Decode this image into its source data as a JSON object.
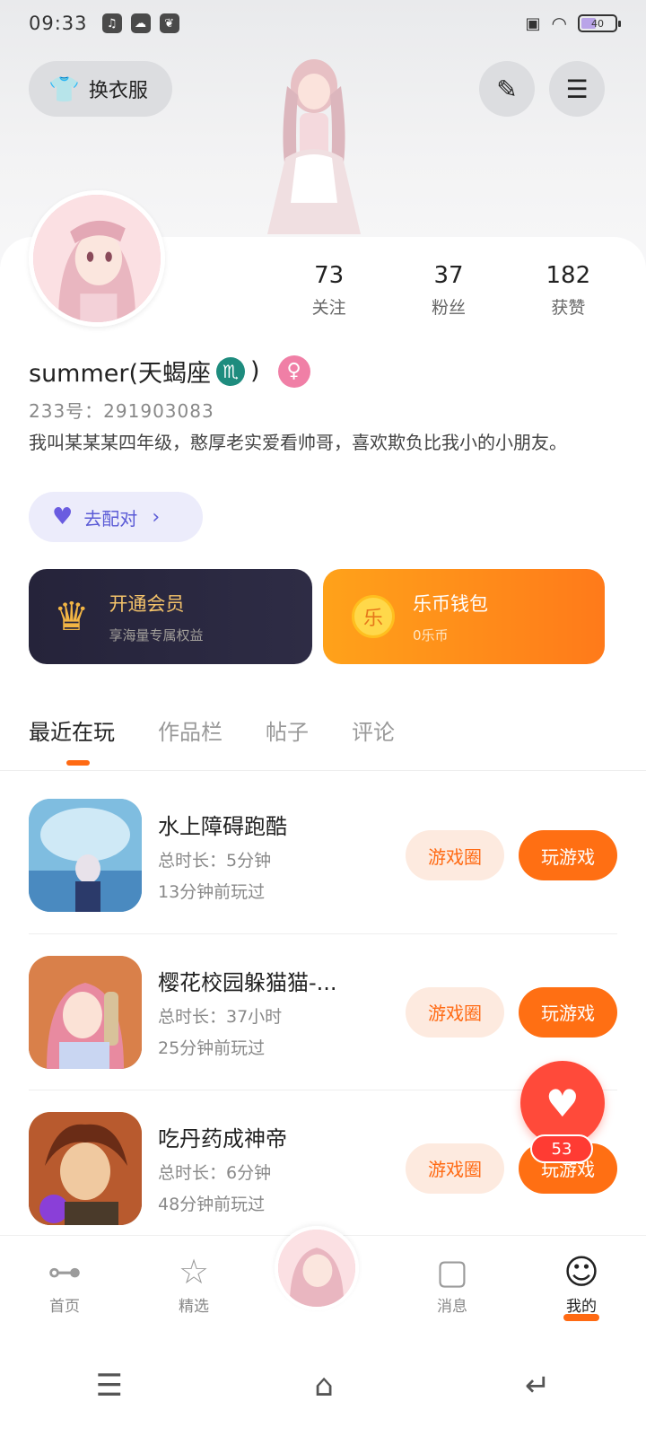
{
  "status_bar": {
    "time": "09:33",
    "battery": "40"
  },
  "header": {
    "dressup_label": "换衣服"
  },
  "profile": {
    "stats": [
      {
        "value": "73",
        "label": "关注"
      },
      {
        "value": "37",
        "label": "粉丝"
      },
      {
        "value": "182",
        "label": "获赞"
      }
    ],
    "username": "summer(天蝎座",
    "username_suffix": ")",
    "zodiac_symbol": "♏",
    "gender_symbol": "♀",
    "uid": "233号：291903083",
    "bio": "我叫某某某四年级，憨厚老实爱看帅哥，喜欢欺负比我小的小朋友。",
    "match_label": "去配对"
  },
  "cards": {
    "vip_title": "开通会员",
    "vip_sub": "享海量专属权益",
    "wallet_coin": "乐",
    "wallet_title": "乐币钱包",
    "wallet_sub": "0乐币"
  },
  "tabs": [
    {
      "label": "最近在玩",
      "active": true
    },
    {
      "label": "作品栏",
      "active": false
    },
    {
      "label": "帖子",
      "active": false
    },
    {
      "label": "评论",
      "active": false
    }
  ],
  "games": [
    {
      "title": "水上障碍跑酷",
      "duration": "总时长：5分钟",
      "last_played": "13分钟前玩过",
      "circle_label": "游戏圈",
      "play_label": "玩游戏"
    },
    {
      "title": "樱花校园躲猫猫-...",
      "duration": "总时长：37小时",
      "last_played": "25分钟前玩过",
      "circle_label": "游戏圈",
      "play_label": "玩游戏"
    },
    {
      "title": "吃丹药成神帝",
      "duration": "总时长：6分钟",
      "last_played": "48分钟前玩过",
      "circle_label": "游戏圈",
      "play_label": "玩游戏"
    }
  ],
  "fab": {
    "count": "53"
  },
  "bottom_nav": [
    {
      "label": "首页",
      "icon": "gamepad-icon"
    },
    {
      "label": "精选",
      "icon": "star-icon"
    },
    {
      "label": "消息",
      "icon": "chat-icon"
    },
    {
      "label": "我的",
      "icon": "smile-icon"
    }
  ],
  "colors": {
    "accent": "#ff6a13",
    "vip_bg": "#25233a",
    "fab": "#ff4a3a"
  }
}
